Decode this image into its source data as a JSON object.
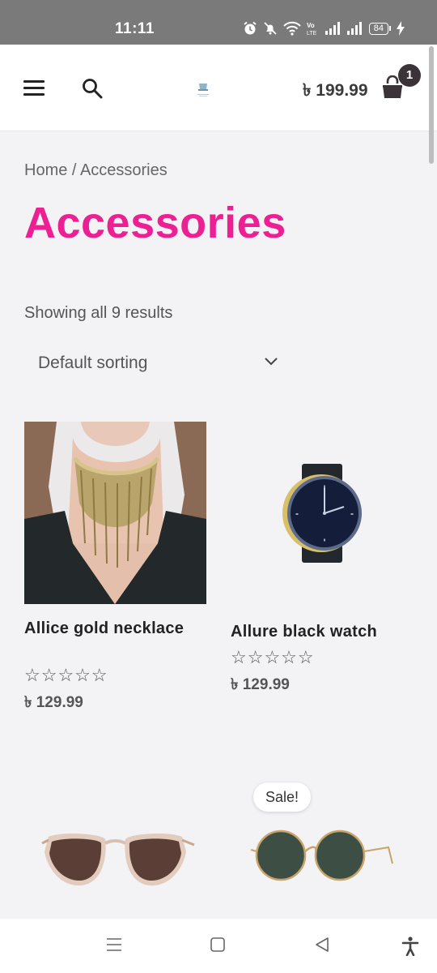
{
  "status_bar": {
    "time": "11:11",
    "battery": "84"
  },
  "header": {
    "cart_total": "৳ 199.99",
    "cart_count": "1",
    "icons": [
      "menu-icon",
      "search-icon",
      "logo",
      "shopping-bag-icon"
    ]
  },
  "breadcrumb": {
    "home": "Home",
    "separator": " / ",
    "current": "Accessories"
  },
  "page_title": "Accessories",
  "result_count": "Showing all 9 results",
  "sorting": {
    "selected": "Default sorting"
  },
  "products": [
    {
      "title": "Allice gold necklace",
      "rating": "☆☆☆☆☆",
      "price": "৳ 129.99"
    },
    {
      "title": "Allure black watch",
      "rating": "☆☆☆☆☆",
      "price": "৳ 129.99"
    },
    {
      "title": "",
      "rating": "",
      "price": ""
    },
    {
      "title": "",
      "rating": "",
      "price": "",
      "badge": "Sale!"
    }
  ],
  "colors": {
    "accent": "#ec1f93",
    "background": "#f3f2f4",
    "status_bar": "#7a7a7a"
  }
}
